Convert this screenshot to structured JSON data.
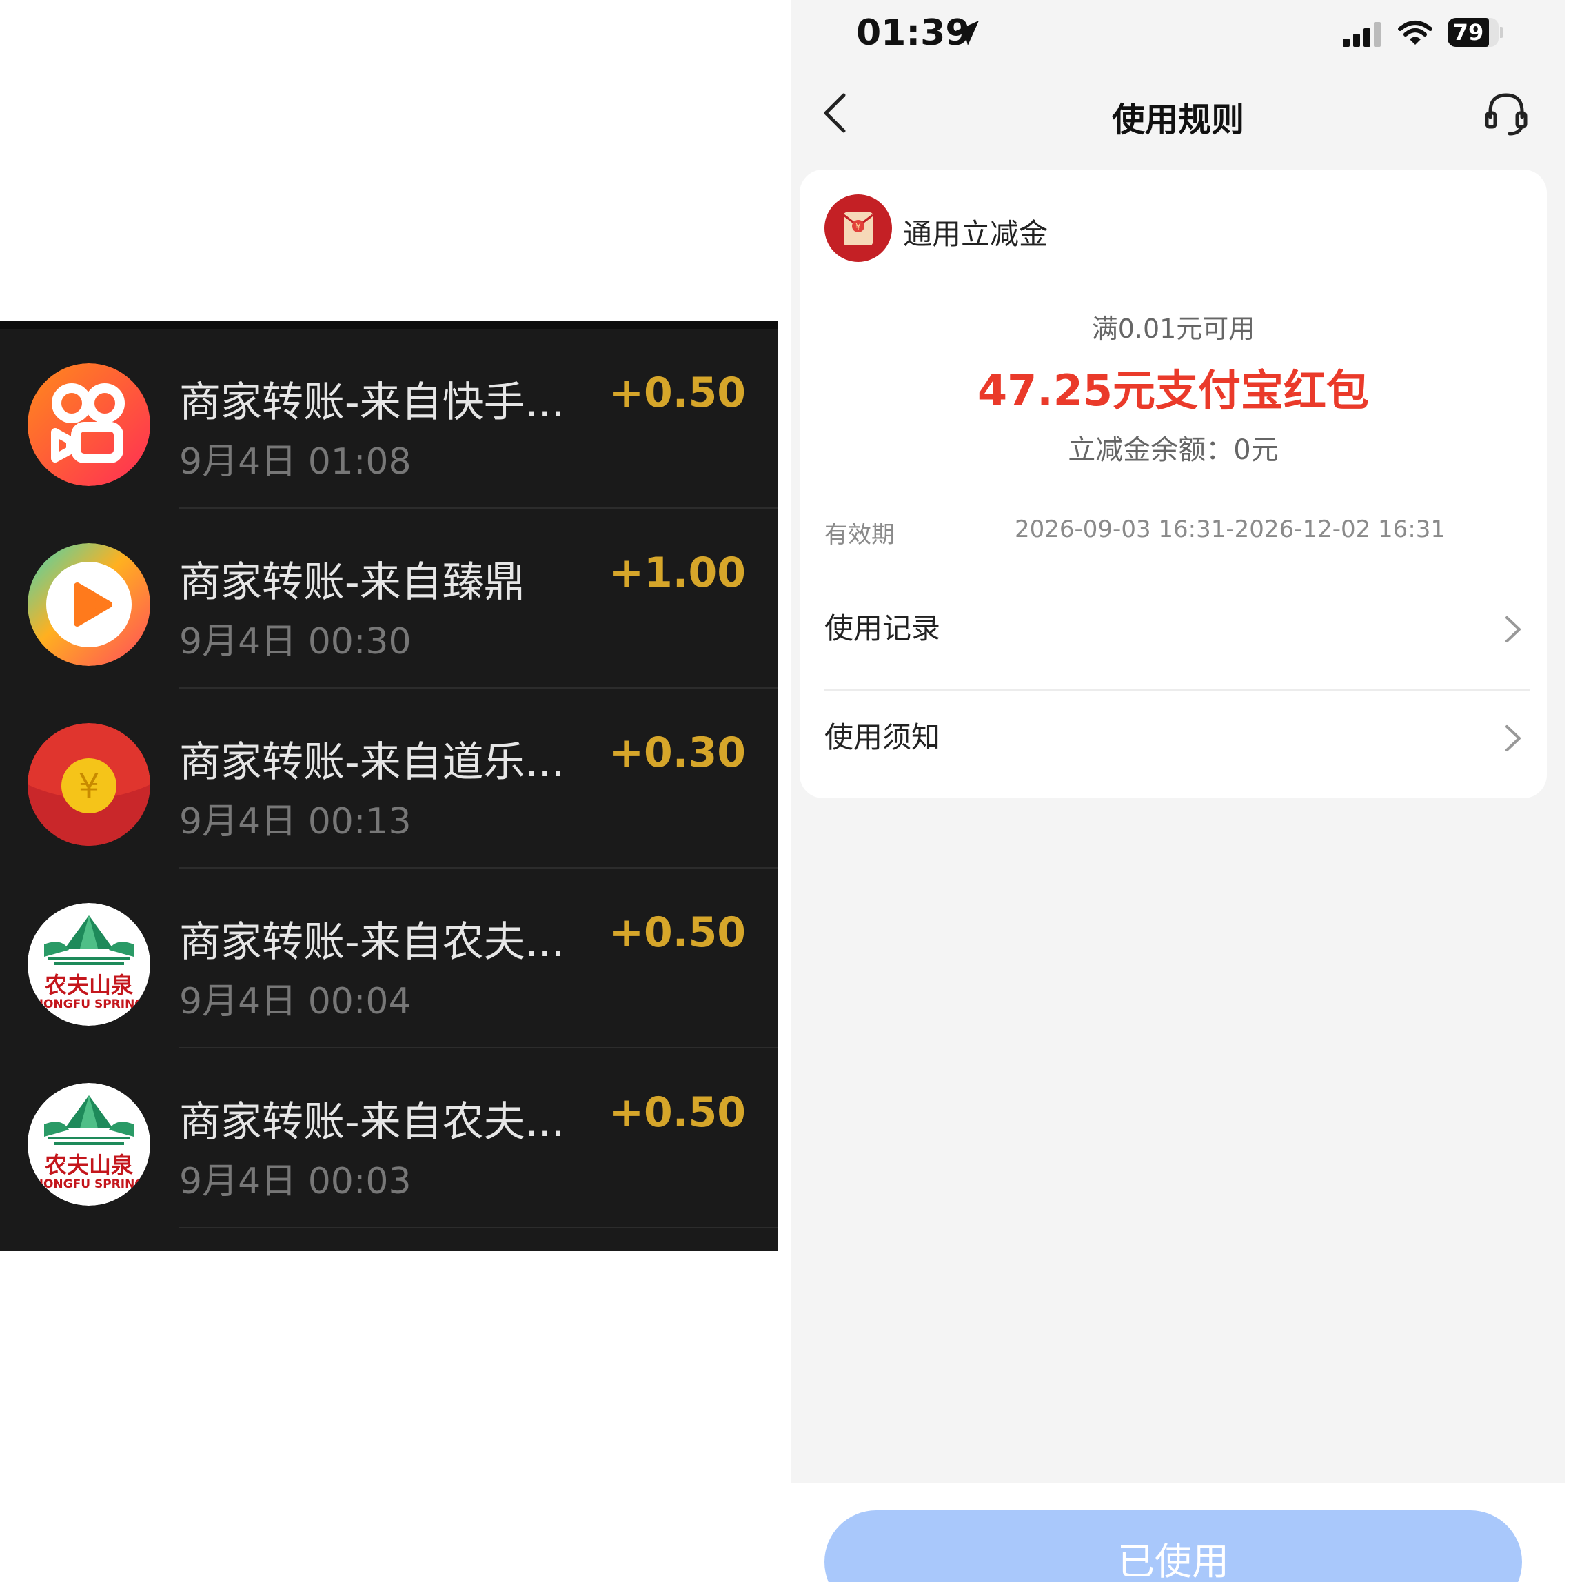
{
  "transactions": [
    {
      "title": "商家转账-来自快手...",
      "time": "9月4日 01:08",
      "amount": "+0.50",
      "icon": "kuaishou-logo-icon"
    },
    {
      "title": "商家转账-来自臻鼎",
      "time": "9月4日 00:30",
      "amount": "+1.00",
      "icon": "video-play-logo-icon"
    },
    {
      "title": "商家转账-来自道乐...",
      "time": "9月4日 00:13",
      "amount": "+0.30",
      "icon": "red-envelope-icon",
      "logo_text": "¥"
    },
    {
      "title": "商家转账-来自农夫...",
      "time": "9月4日 00:04",
      "amount": "+0.50",
      "icon": "nongfu-spring-logo-icon",
      "logo_text": "农夫山泉",
      "logo_sub": "NONGFU SPRING"
    },
    {
      "title": "商家转账-来自农夫...",
      "time": "9月4日 00:03",
      "amount": "+0.50",
      "icon": "nongfu-spring-logo-icon",
      "logo_text": "农夫山泉",
      "logo_sub": "NONGFU SPRING"
    }
  ],
  "status_bar": {
    "time": "01:39",
    "battery": "79"
  },
  "nav": {
    "title": "使用规则"
  },
  "coupon": {
    "name": "通用立减金",
    "condition": "满0.01元可用",
    "amount_title": "47.25元支付宝红包",
    "balance": "立减金余额：0元",
    "validity_label": "有效期",
    "validity_value": "2026-09-03 16:31-2026-12-02 16:31"
  },
  "rows": [
    {
      "label": "使用记录"
    },
    {
      "label": "使用须知"
    }
  ],
  "button": {
    "label": "已使用"
  },
  "colors": {
    "amount_gold": "#d6a62a",
    "accent_red": "#ea3a2a",
    "button_blue": "#a9c8fb"
  }
}
